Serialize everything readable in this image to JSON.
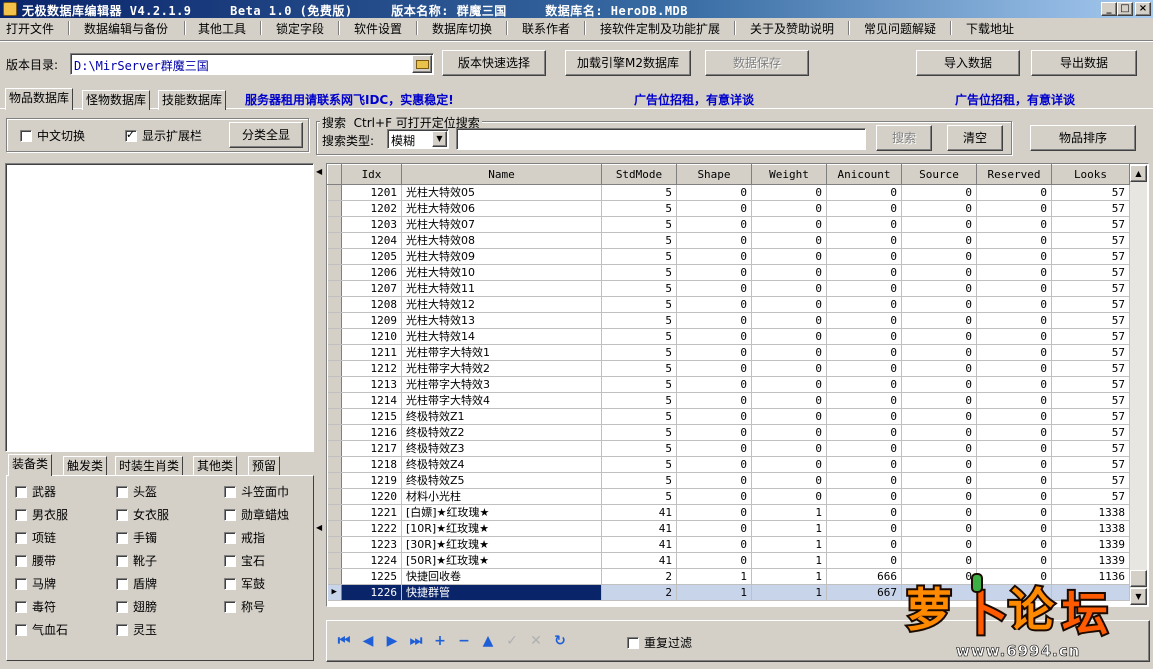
{
  "title": {
    "text": "无极数据库编辑器 V4.2.1.9     Beta 1.0 (免费版)     版本名称: 群魔三国     数据库名: HeroDB.MDB",
    "minimize": "_",
    "maximize": "□",
    "close": "×"
  },
  "menu": [
    "打开文件",
    "数据编辑与备份",
    "其他工具",
    "锁定字段",
    "软件设置",
    "数据库切换",
    "联系作者",
    "接软件定制及功能扩展",
    "关于及赞助说明",
    "常见问题解疑",
    "下载地址"
  ],
  "toolbar": {
    "dir_label": "版本目录:",
    "dir_value": "D:\\MirServer群魔三国",
    "quick_select": "版本快速选择",
    "load_engine": "加载引擎M2数据库",
    "save_data": "数据保存",
    "import_data": "导入数据",
    "export_data": "导出数据"
  },
  "tabs": [
    "物品数据库",
    "怪物数据库",
    "技能数据库"
  ],
  "banner": {
    "server": "服务器租用请联系网飞IDC，实惠稳定!",
    "ad1": "广告位招租，有意详谈",
    "ad2": "广告位招租，有意详谈"
  },
  "options": {
    "chinese_switch": "中文切换",
    "show_extension": "显示扩展栏",
    "show_all": "分类全显"
  },
  "search": {
    "group_label": "搜索",
    "hint": "Ctrl+F 可打开定位搜索",
    "type_label": "搜索类型:",
    "type_value": "模糊",
    "input_value": "",
    "search_button": "搜索",
    "clear_button": "清空"
  },
  "sort_button": "物品排序",
  "grid": {
    "columns": [
      "Idx",
      "Name",
      "StdMode",
      "Shape",
      "Weight",
      "Anicount",
      "Source",
      "Reserved",
      "Looks"
    ],
    "rows": [
      [
        "1201",
        "光柱大特效05",
        "5",
        "0",
        "0",
        "0",
        "0",
        "0",
        "57"
      ],
      [
        "1202",
        "光柱大特效06",
        "5",
        "0",
        "0",
        "0",
        "0",
        "0",
        "57"
      ],
      [
        "1203",
        "光柱大特效07",
        "5",
        "0",
        "0",
        "0",
        "0",
        "0",
        "57"
      ],
      [
        "1204",
        "光柱大特效08",
        "5",
        "0",
        "0",
        "0",
        "0",
        "0",
        "57"
      ],
      [
        "1205",
        "光柱大特效09",
        "5",
        "0",
        "0",
        "0",
        "0",
        "0",
        "57"
      ],
      [
        "1206",
        "光柱大特效10",
        "5",
        "0",
        "0",
        "0",
        "0",
        "0",
        "57"
      ],
      [
        "1207",
        "光柱大特效11",
        "5",
        "0",
        "0",
        "0",
        "0",
        "0",
        "57"
      ],
      [
        "1208",
        "光柱大特效12",
        "5",
        "0",
        "0",
        "0",
        "0",
        "0",
        "57"
      ],
      [
        "1209",
        "光柱大特效13",
        "5",
        "0",
        "0",
        "0",
        "0",
        "0",
        "57"
      ],
      [
        "1210",
        "光柱大特效14",
        "5",
        "0",
        "0",
        "0",
        "0",
        "0",
        "57"
      ],
      [
        "1211",
        "光柱带字大特效1",
        "5",
        "0",
        "0",
        "0",
        "0",
        "0",
        "57"
      ],
      [
        "1212",
        "光柱带字大特效2",
        "5",
        "0",
        "0",
        "0",
        "0",
        "0",
        "57"
      ],
      [
        "1213",
        "光柱带字大特效3",
        "5",
        "0",
        "0",
        "0",
        "0",
        "0",
        "57"
      ],
      [
        "1214",
        "光柱带字大特效4",
        "5",
        "0",
        "0",
        "0",
        "0",
        "0",
        "57"
      ],
      [
        "1215",
        "终极特效Z1",
        "5",
        "0",
        "0",
        "0",
        "0",
        "0",
        "57"
      ],
      [
        "1216",
        "终极特效Z2",
        "5",
        "0",
        "0",
        "0",
        "0",
        "0",
        "57"
      ],
      [
        "1217",
        "终极特效Z3",
        "5",
        "0",
        "0",
        "0",
        "0",
        "0",
        "57"
      ],
      [
        "1218",
        "终极特效Z4",
        "5",
        "0",
        "0",
        "0",
        "0",
        "0",
        "57"
      ],
      [
        "1219",
        "终极特效Z5",
        "5",
        "0",
        "0",
        "0",
        "0",
        "0",
        "57"
      ],
      [
        "1220",
        "材料小光柱",
        "5",
        "0",
        "0",
        "0",
        "0",
        "0",
        "57"
      ],
      [
        "1221",
        "[白嫖]★红玫瑰★",
        "41",
        "0",
        "1",
        "0",
        "0",
        "0",
        "1338"
      ],
      [
        "1222",
        "[10R]★红玫瑰★",
        "41",
        "0",
        "1",
        "0",
        "0",
        "0",
        "1338"
      ],
      [
        "1223",
        "[30R]★红玫瑰★",
        "41",
        "0",
        "1",
        "0",
        "0",
        "0",
        "1339"
      ],
      [
        "1224",
        "[50R]★红玫瑰★",
        "41",
        "0",
        "1",
        "0",
        "0",
        "0",
        "1339"
      ],
      [
        "1225",
        "快捷回收卷",
        "2",
        "1",
        "1",
        "666",
        "0",
        "0",
        "1136"
      ],
      [
        "1226",
        "快捷群管",
        "2",
        "1",
        "1",
        "667",
        "",
        "",
        ""
      ]
    ],
    "selected_index": 25
  },
  "category_tabs": [
    "装备类",
    "触发类",
    "时装生肖类",
    "其他类",
    "预留"
  ],
  "categories": [
    "武器",
    "头盔",
    "斗笠面巾",
    "男衣服",
    "女衣服",
    "勋章蜡烛",
    "项链",
    "手镯",
    "戒指",
    "腰带",
    "靴子",
    "宝石",
    "马牌",
    "盾牌",
    "军鼓",
    "毒符",
    "翅膀",
    "称号",
    "气血石",
    "灵玉"
  ],
  "nav": {
    "icons": [
      "first-icon",
      "prior-icon",
      "next-icon",
      "last-icon",
      "insert-icon",
      "delete-icon",
      "edit-icon",
      "post-icon",
      "cancel-icon",
      "refresh-icon"
    ],
    "glyphs": [
      "⏮",
      "◀",
      "▶",
      "⏭",
      "+",
      "−",
      "▲",
      "✓",
      "✕",
      "↻"
    ],
    "dup_filter": "重复过滤"
  },
  "watermark": {
    "logo": "萝卜论坛",
    "url": "www.6994.cn"
  }
}
